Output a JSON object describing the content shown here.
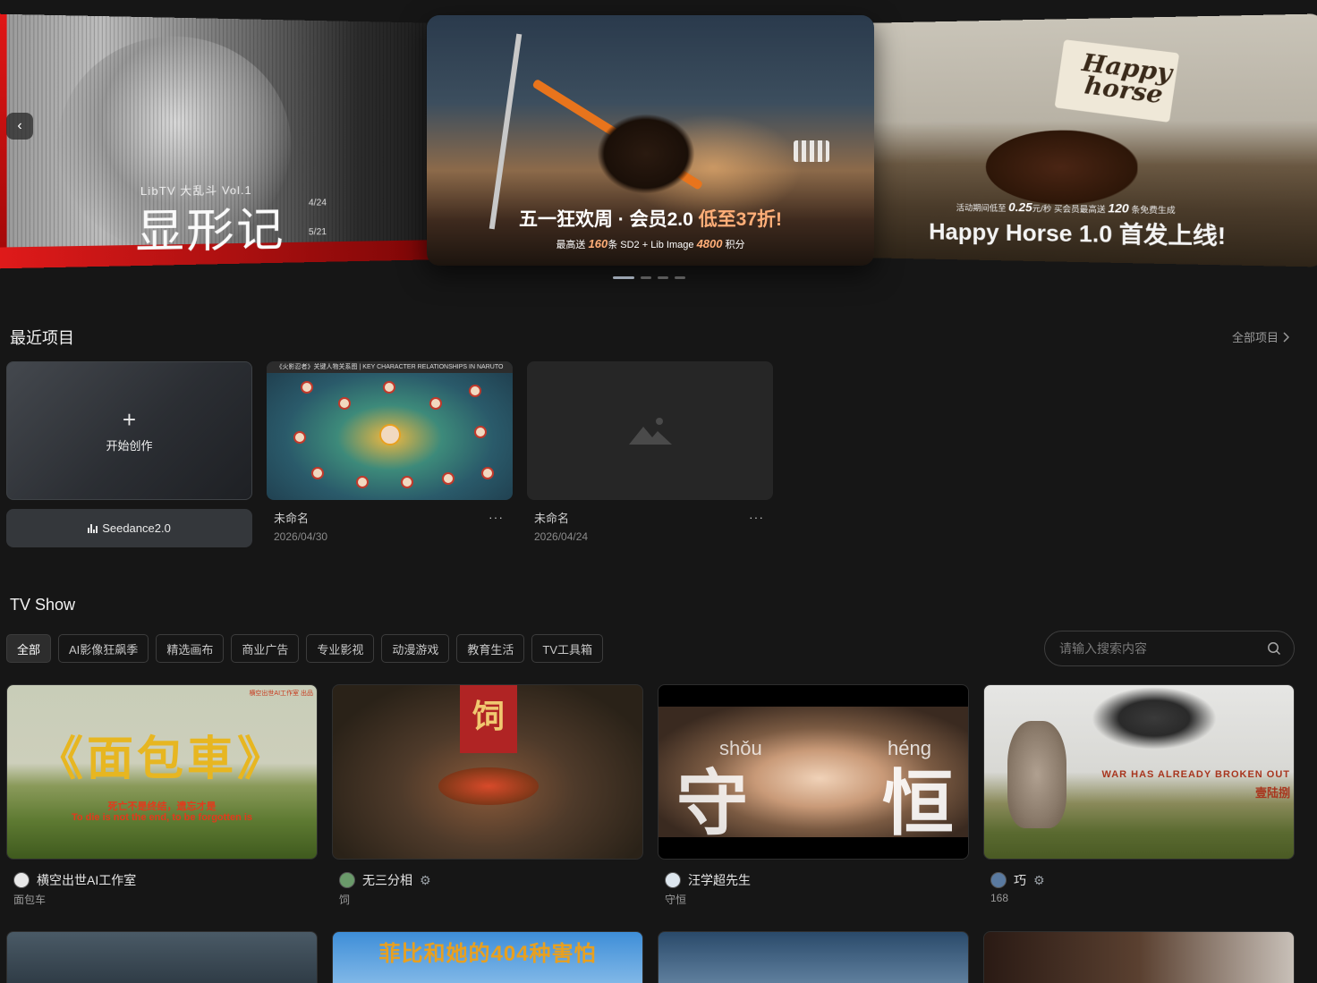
{
  "carousel": {
    "left_banner": {
      "subtitle": "LibTV 大乱斗   Vol.1",
      "title": "显形记",
      "date_start": "4/24",
      "date_end": "5/21"
    },
    "center_banner": {
      "title_prefix": "五一狂欢周 · 会员2.0 ",
      "title_highlight": "低至37折!",
      "sub_prefix": "最高送 ",
      "sub_v1": "160",
      "sub_mid": "条 SD2 + Lib Image ",
      "sub_v2": "4800",
      "sub_suffix": " 积分"
    },
    "right_banner": {
      "flag_text": "Happy horse",
      "promo_prefix": "活动期间低至 ",
      "promo_price": "0.25",
      "promo_mid": "元/秒 买会员最高送 ",
      "promo_count": "120",
      "promo_suffix": " 条免费生成",
      "title": "Happy Horse 1.0 首发上线!"
    },
    "prev_icon": "‹",
    "dots": 4,
    "active_dot": 0
  },
  "recent": {
    "title": "最近项目",
    "all_link": "全部项目",
    "start_label": "开始创作",
    "plus_icon": "+",
    "seedance_label": "Seedance2.0",
    "projects": [
      {
        "name": "未命名",
        "date": "2026/04/30",
        "header": "《火影忍者》关键人物关系图 | KEY CHARACTER RELATIONSHIPS IN NARUTO"
      },
      {
        "name": "未命名",
        "date": "2026/04/24"
      }
    ],
    "more_icon": "···"
  },
  "tvshow": {
    "title": "TV Show",
    "tabs": [
      "全部",
      "AI影像狂飙季",
      "精选画布",
      "商业广告",
      "专业影视",
      "动漫游戏",
      "教育生活",
      "TV工具箱"
    ],
    "active_tab": 0,
    "search_placeholder": "请输入搜索内容",
    "cards": [
      {
        "author": "横空出世AI工作室",
        "title": "面包车",
        "poster_title": "《面包車》",
        "line1": "死亡不是终结，遗忘才是",
        "line2": "To die is not the end, to be forgotten is",
        "corner": "横空出世AI工作室 出品",
        "avatar_color": "#e8e8e8",
        "verified": false
      },
      {
        "author": "无三分相",
        "title": "饲",
        "poster_char": "饲",
        "avatar_color": "#6a9a6a",
        "verified": true
      },
      {
        "author": "汪学超先生",
        "title": "守恒",
        "pinyin1": "shǒu",
        "pinyin2": "héng",
        "char1": "守",
        "char2": "恒",
        "avatar_color": "#dde6ee",
        "verified": false
      },
      {
        "author": "巧",
        "title": "168",
        "line1": "WAR HAS ALREADY BROKEN OUT",
        "line2": "壹陆捌",
        "avatar_color": "#5a7aa0",
        "verified": true
      }
    ],
    "row2": {
      "poster_text": "菲比和她的404种害怕"
    }
  }
}
